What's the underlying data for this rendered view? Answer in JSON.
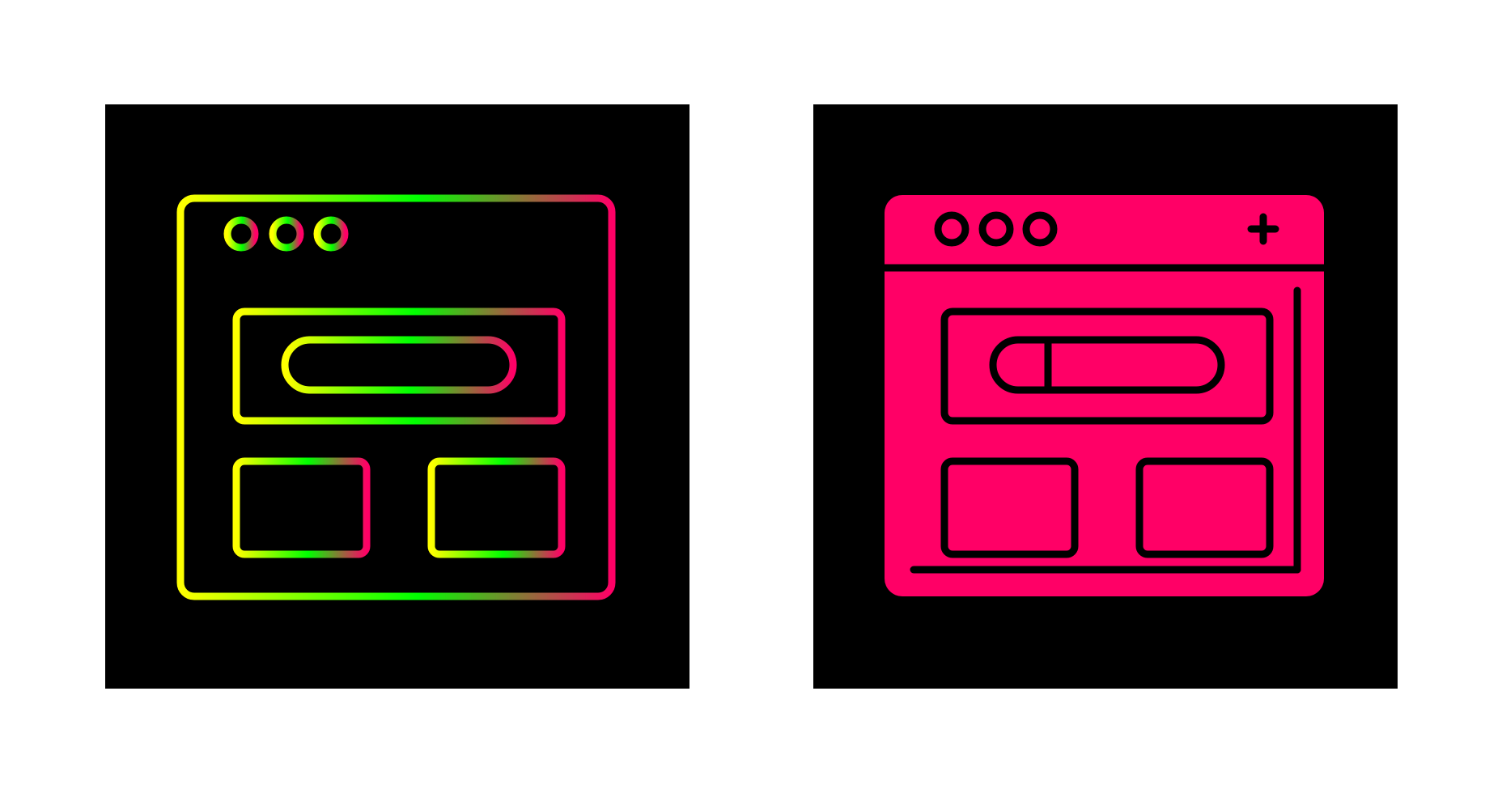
{
  "icons": [
    {
      "name": "browser-window-icon",
      "style": "outline-gradient",
      "gradient_colors": [
        "#ffff00",
        "#00ff00",
        "#ff0066"
      ]
    },
    {
      "name": "browser-window-icon",
      "style": "glyph",
      "fill_color": "#ff0066",
      "line_color": "#000000"
    }
  ],
  "colors": {
    "page_background": "#ffffff",
    "tile_background": "#000000"
  }
}
